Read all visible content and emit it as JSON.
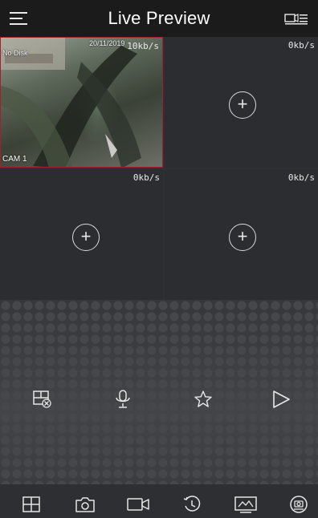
{
  "header": {
    "title": "Live Preview",
    "menu_icon": "hamburger-menu-icon",
    "preview_settings_icon": "camera-list-icon"
  },
  "panes": [
    {
      "rate": "10kb/s",
      "camera_label": "CAM 1",
      "overlay_date": "20/11/2019",
      "overlay_status": "No Disk",
      "selected": true
    },
    {
      "rate": "0kb/s",
      "add_icon": "add-camera-icon"
    },
    {
      "rate": "0kb/s",
      "add_icon": "add-camera-icon"
    },
    {
      "rate": "0kb/s",
      "add_icon": "add-camera-icon"
    }
  ],
  "controls": [
    {
      "icon": "window-layout-icon"
    },
    {
      "icon": "microphone-icon"
    },
    {
      "icon": "star-favorite-icon"
    },
    {
      "icon": "play-icon"
    }
  ],
  "toolbar": [
    {
      "icon": "grid-split-icon"
    },
    {
      "icon": "snapshot-camera-icon"
    },
    {
      "icon": "record-video-icon"
    },
    {
      "icon": "playback-clock-icon"
    },
    {
      "icon": "image-quality-icon"
    },
    {
      "icon": "ptz-control-icon"
    }
  ],
  "colors": {
    "header_bg": "#1b1b1c",
    "selected_border": "#a0202e",
    "pane_bg": "#2c2d31",
    "toolbar_bg": "#2e2f33"
  }
}
